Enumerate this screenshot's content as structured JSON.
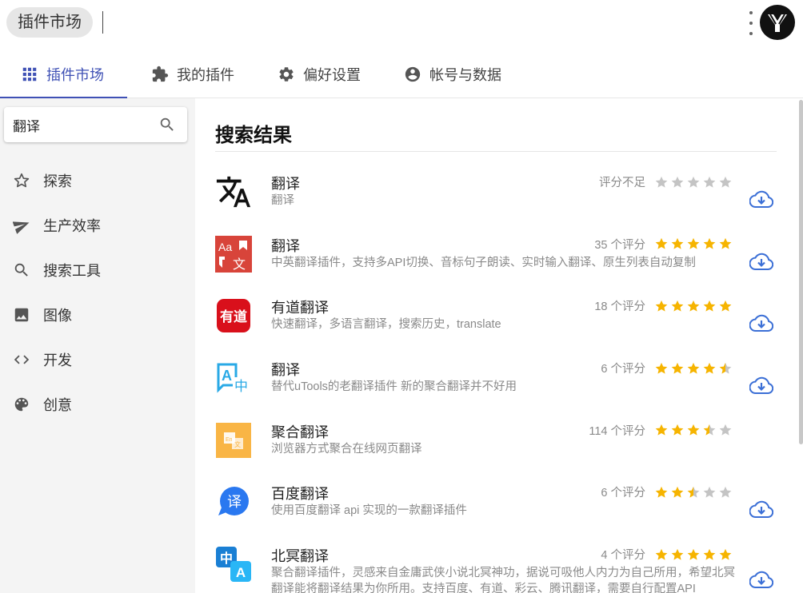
{
  "header": {
    "title": "插件市场"
  },
  "tabs": [
    {
      "label": "插件市场",
      "icon": "grid-icon",
      "active": true
    },
    {
      "label": "我的插件",
      "icon": "puzzle-icon"
    },
    {
      "label": "偏好设置",
      "icon": "gear-icon"
    },
    {
      "label": "帐号与数据",
      "icon": "account-circle-icon"
    }
  ],
  "search": {
    "value": "翻译"
  },
  "categories": [
    {
      "label": "探索",
      "icon": "star-outline-icon"
    },
    {
      "label": "生产效率",
      "icon": "send-icon"
    },
    {
      "label": "搜索工具",
      "icon": "search-icon"
    },
    {
      "label": "图像",
      "icon": "image-icon"
    },
    {
      "label": "开发",
      "icon": "code-icon"
    },
    {
      "label": "创意",
      "icon": "palette-icon"
    }
  ],
  "main": {
    "section_title": "搜索结果",
    "results": [
      {
        "name": "翻译",
        "desc": "翻译",
        "rating_text": "评分不足",
        "rating": 0,
        "icon": "translate-icon"
      },
      {
        "name": "翻译",
        "desc": "中英翻译插件，支持多API切换、音标句子朗读、实时输入翻译、原生列表自动复制",
        "rating_text": "35 个评分",
        "rating": 5,
        "icon": "aa-translate-icon"
      },
      {
        "name": "有道翻译",
        "desc": "快速翻译，多语言翻译，搜索历史，translate",
        "rating_text": "18 个评分",
        "rating": 5,
        "icon": "youdao-icon",
        "icon_text": "有道"
      },
      {
        "name": "翻译",
        "desc": "替代uTools的老翻译插件 新的聚合翻译并不好用",
        "rating_text": "6 个评分",
        "rating": 4.5,
        "icon": "a-zhong-icon"
      },
      {
        "name": "聚合翻译",
        "desc": "浏览器方式聚合在线网页翻译",
        "rating_text": "114 个评分",
        "rating": 3.5,
        "icon": "aggregate-translate-icon"
      },
      {
        "name": "百度翻译",
        "desc": "使用百度翻译 api 实现的一款翻译插件",
        "rating_text": "6 个评分",
        "rating": 2.5,
        "icon": "baidu-translate-icon",
        "icon_text": "译"
      },
      {
        "name": "北冥翻译",
        "desc": "聚合翻译插件，灵感来自金庸武侠小说北冥神功，据说可吸他人内力为自己所用，希望北冥翻译能将翻译结果为你所用。支持百度、有道、彩云、腾讯翻译，需要自行配置API",
        "rating_text": "4 个评分",
        "rating": 5,
        "icon": "beiming-translate-icon",
        "icon_text": "中"
      }
    ]
  },
  "colors": {
    "accent": "#3f51b5",
    "star": "#f6b400",
    "star_empty": "#c4c4c4",
    "download": "#3b6fd6"
  }
}
